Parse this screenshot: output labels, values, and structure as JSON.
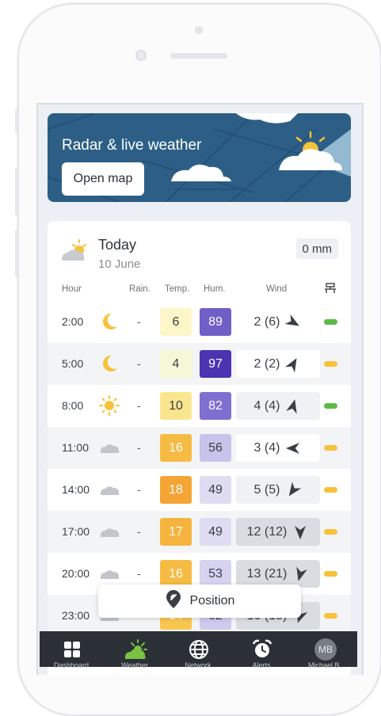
{
  "radar": {
    "title": "Radar & live weather",
    "button_label": "Open map"
  },
  "forecast": {
    "day": "Today",
    "date": "10 June",
    "rain_total": "0 mm",
    "headers": {
      "hour": "Hour",
      "rain": "Rain.",
      "temp": "Temp.",
      "hum": "Hum.",
      "wind": "Wind",
      "status_icon": "bench-icon"
    },
    "rows": [
      {
        "hour": "2:00",
        "icon": "moon",
        "rain": "-",
        "temp": "6",
        "hum": "89",
        "wind": "2 (6)",
        "dir": 120,
        "temp_bg": "#fdf6c8",
        "temp_fg": "#3a3f44",
        "hum_bg": "#6f5fc7",
        "hum_fg": "#ffffff",
        "wind_bg": "#ffffff",
        "status": "#5cbb47"
      },
      {
        "hour": "5:00",
        "icon": "moon",
        "rain": "-",
        "temp": "4",
        "hum": "97",
        "wind": "2 (2)",
        "dir": 30,
        "temp_bg": "#f6f7d6",
        "temp_fg": "#3a3f44",
        "hum_bg": "#4a34b0",
        "hum_fg": "#ffffff",
        "wind_bg": "#ffffff",
        "status": "#f6c23a"
      },
      {
        "hour": "8:00",
        "icon": "sun",
        "rain": "-",
        "temp": "10",
        "hum": "82",
        "wind": "4 (4)",
        "dir": 15,
        "temp_bg": "#fbe690",
        "temp_fg": "#3a3f44",
        "hum_bg": "#7e6fd0",
        "hum_fg": "#ffffff",
        "wind_bg": "#f0f1f4",
        "status": "#5cbb47"
      },
      {
        "hour": "11:00",
        "icon": "cloud",
        "rain": "-",
        "temp": "16",
        "hum": "56",
        "wind": "3 (4)",
        "dir": 270,
        "temp_bg": "#f6bb42",
        "temp_fg": "#ffffff",
        "hum_bg": "#c8c3ea",
        "hum_fg": "#3a3f44",
        "wind_bg": "#ffffff",
        "status": "#f6c23a"
      },
      {
        "hour": "14:00",
        "icon": "cloud",
        "rain": "-",
        "temp": "18",
        "hum": "49",
        "wind": "5 (5)",
        "dir": 215,
        "temp_bg": "#f4a534",
        "temp_fg": "#ffffff",
        "hum_bg": "#dedbf2",
        "hum_fg": "#3a3f44",
        "wind_bg": "#f0f1f4",
        "status": "#f6c23a"
      },
      {
        "hour": "17:00",
        "icon": "cloud",
        "rain": "-",
        "temp": "17",
        "hum": "49",
        "wind": "12 (12)",
        "dir": 180,
        "temp_bg": "#f6b43e",
        "temp_fg": "#ffffff",
        "hum_bg": "#dedbf2",
        "hum_fg": "#3a3f44",
        "wind_bg": "#d9dce1",
        "status": "#f6c23a"
      },
      {
        "hour": "20:00",
        "icon": "cloud",
        "rain": "-",
        "temp": "16",
        "hum": "53",
        "wind": "13 (21)",
        "dir": 195,
        "temp_bg": "#f6bb42",
        "temp_fg": "#ffffff",
        "hum_bg": "#d6d2f0",
        "hum_fg": "#3a3f44",
        "wind_bg": "#d9dce1",
        "status": "#f6c23a"
      },
      {
        "hour": "23:00",
        "icon": "cloud",
        "rain": "-",
        "temp": "14",
        "hum": "62",
        "wind": "10 (15)",
        "dir": 200,
        "temp_bg": "#f8c74f",
        "temp_fg": "#ffffff",
        "hum_bg": "#cfcaee",
        "hum_fg": "#3a3f44",
        "wind_bg": "#d9dce1",
        "status": "#f6c23a"
      }
    ]
  },
  "toast": {
    "label": "Position",
    "icon": "location-pin-icon"
  },
  "nav": [
    {
      "id": "dashboard",
      "label": "Dashboard",
      "icon": "grid-icon"
    },
    {
      "id": "weather",
      "label": "Weather",
      "icon": "sun-cloud-icon",
      "active": true
    },
    {
      "id": "network",
      "label": "Network",
      "icon": "globe-icon"
    },
    {
      "id": "alerts",
      "label": "Alerts",
      "icon": "alarm-clock-icon"
    },
    {
      "id": "profile",
      "label": "Michael B.",
      "icon": "avatar",
      "initials": "MB"
    }
  ],
  "colors": {
    "accent": "#7ac142",
    "banner": "#2d5f86",
    "nav_bg": "#2b3036"
  }
}
